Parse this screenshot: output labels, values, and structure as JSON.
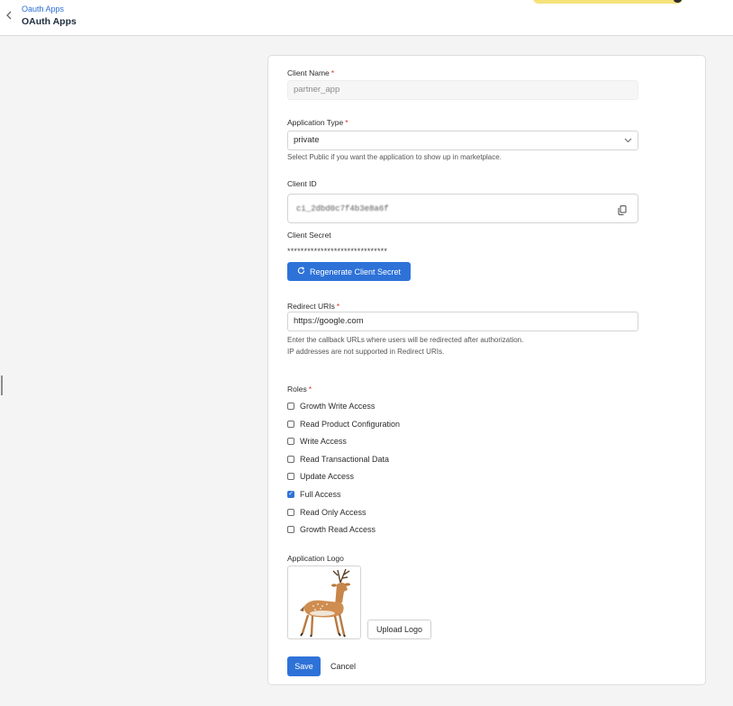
{
  "header": {
    "breadcrumb": "Oauth Apps",
    "title": "OAuth Apps"
  },
  "form": {
    "client_name": {
      "label": "Client Name",
      "value": "partner_app"
    },
    "application_type": {
      "label": "Application Type",
      "value": "private",
      "help": "Select Public if you want the application to show up in marketplace."
    },
    "client_id": {
      "label": "Client ID",
      "value": "ci_2dbd0c7f4b3e8a6f"
    },
    "client_secret": {
      "label": "Client Secret",
      "masked": "******************************",
      "regenerate_label": "Regenerate Client Secret"
    },
    "redirect_uris": {
      "label": "Redirect URIs",
      "value": "https://google.com",
      "help_line1": "Enter the callback URLs where users will be redirected after authorization.",
      "help_line2": "IP addresses are not supported in Redirect URIs."
    },
    "roles": {
      "label": "Roles",
      "items": [
        {
          "label": "Growth Write Access",
          "checked": false
        },
        {
          "label": "Read Product Configuration",
          "checked": false
        },
        {
          "label": "Write Access",
          "checked": false
        },
        {
          "label": "Read Transactional Data",
          "checked": false
        },
        {
          "label": "Update Access",
          "checked": false
        },
        {
          "label": "Full Access",
          "checked": true
        },
        {
          "label": "Read Only Access",
          "checked": false
        },
        {
          "label": "Growth Read Access",
          "checked": false
        }
      ]
    },
    "logo": {
      "label": "Application Logo",
      "upload_label": "Upload Logo"
    },
    "save_label": "Save",
    "cancel_label": "Cancel",
    "required_mark": "*"
  },
  "colors": {
    "primary": "#2e72d8",
    "required": "#d9302c",
    "banner": "#f6e27a"
  }
}
